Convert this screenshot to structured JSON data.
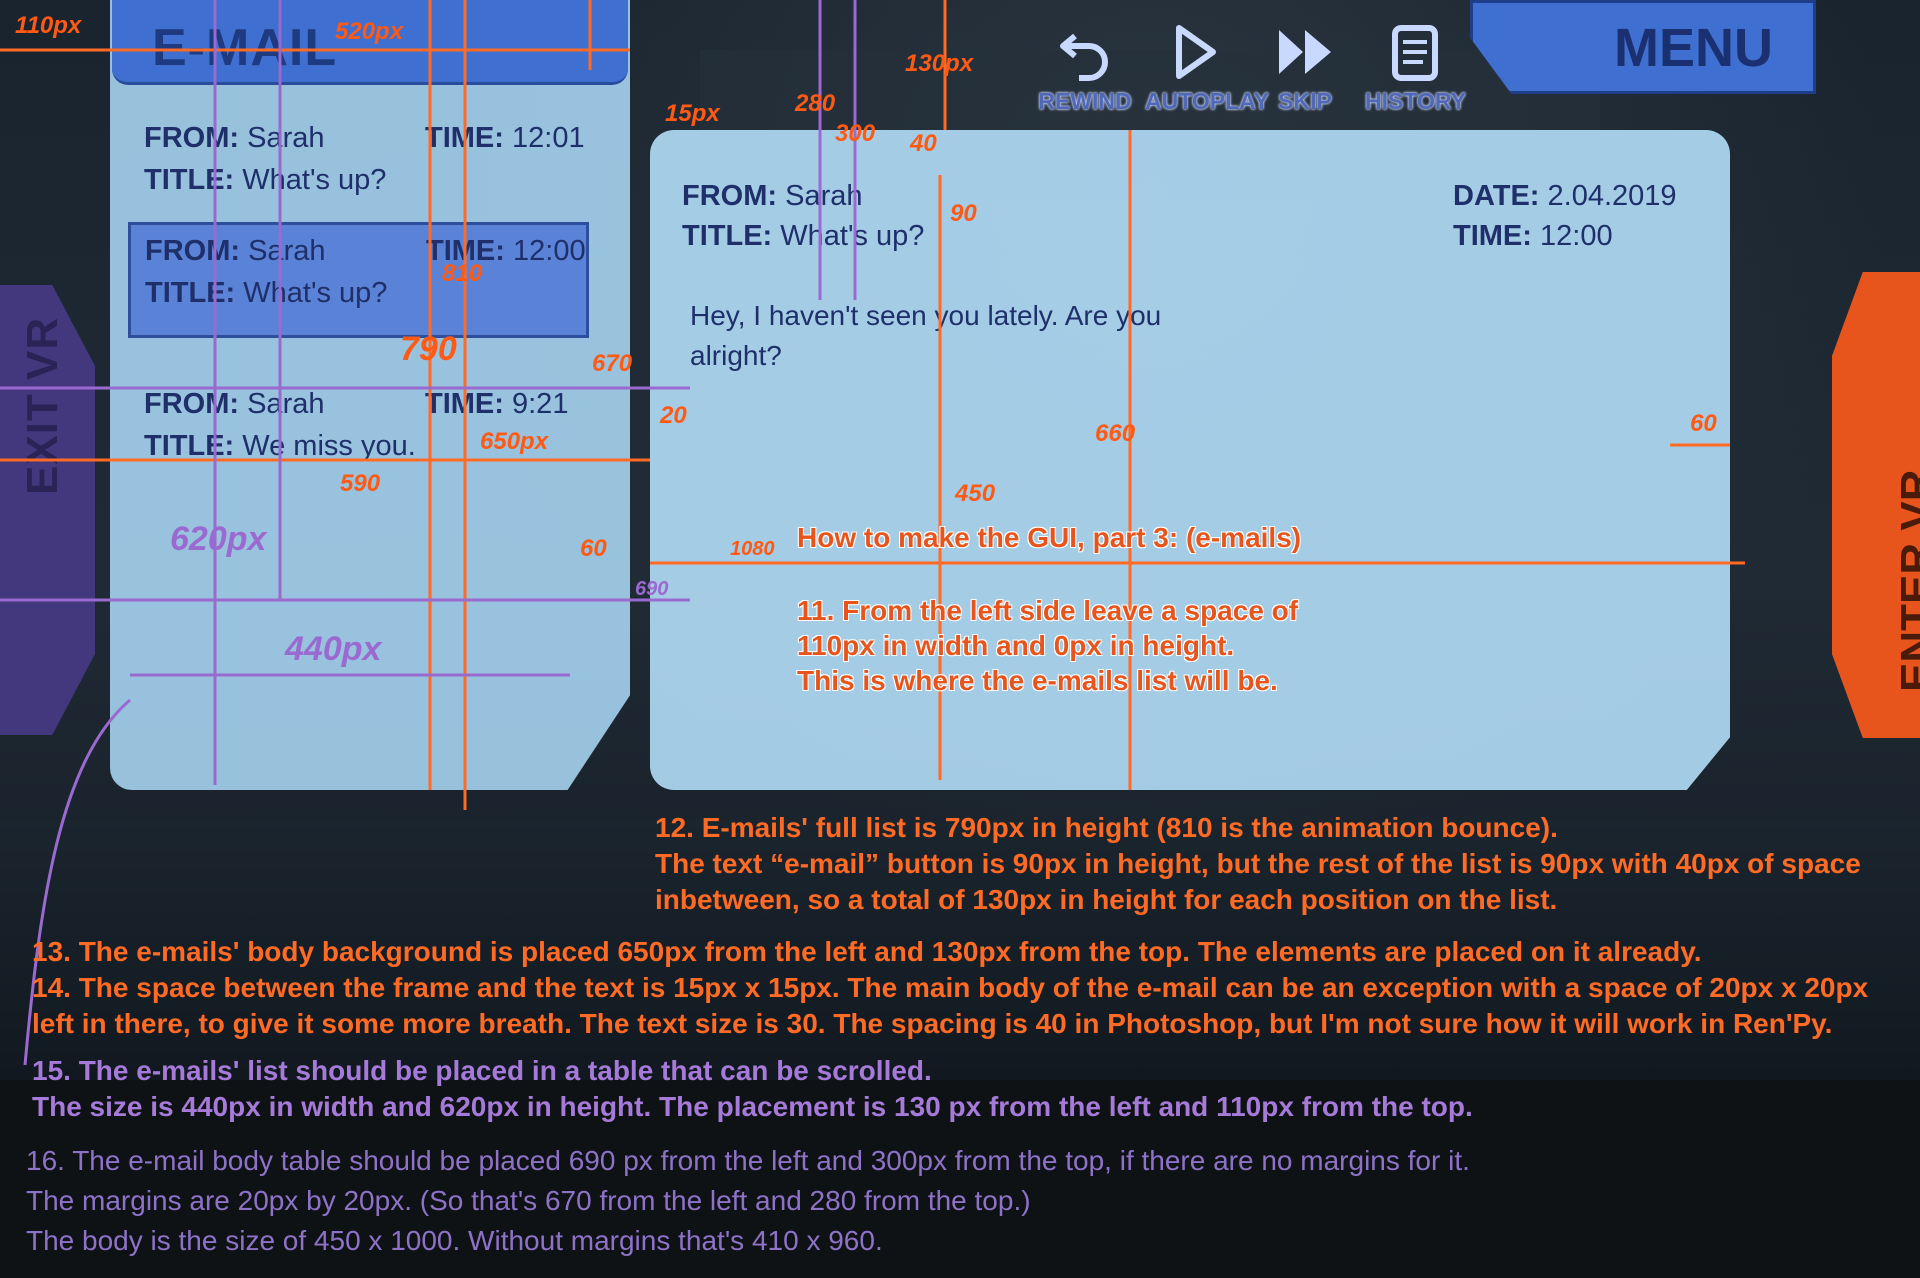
{
  "side": {
    "exit": "EXIT VR",
    "enter": "ENTER VR"
  },
  "topbar": [
    {
      "label": "REWIND",
      "icon": "rewind-icon"
    },
    {
      "label": "AUTOPLAY",
      "icon": "play-icon"
    },
    {
      "label": "SKIP",
      "icon": "skip-icon"
    },
    {
      "label": "HISTORY",
      "icon": "history-icon"
    }
  ],
  "menu": {
    "label": "MENU"
  },
  "list": {
    "header": "E-MAIL",
    "from_label": "FROM:",
    "title_label": "TITLE:",
    "time_label": "TIME:",
    "entries": [
      {
        "from": "Sarah",
        "title": "What's up?",
        "time": "12:01"
      },
      {
        "from": "Sarah",
        "title": "What's up?",
        "time": "12:00"
      },
      {
        "from": "Sarah",
        "title": "We miss you.",
        "time": "9:21"
      }
    ]
  },
  "body": {
    "from_label": "FROM:",
    "from": "Sarah",
    "title_label": "TITLE:",
    "title": "What's up?",
    "date_label": "DATE:",
    "date": "2.04.2019",
    "time_label": "TIME:",
    "time": "12:00",
    "text": "Hey, I haven't seen you lately. Are you alright?"
  },
  "notes": {
    "heading": "How to make the GUI, part 3: (e-mails)",
    "n11_a": "11. From the left side leave a space of",
    "n11_b": "110px in width and 0px in height.",
    "n11_c": "This is where the e-mails list will be."
  },
  "captions": {
    "c12a": "12. E-mails' full list is 790px in height (810 is the animation bounce).",
    "c12b": "The text “e-mail” button is 90px in height, but the rest of the list is 90px with 40px of space",
    "c12c": "inbetween, so a total of 130px in height for each position on the list.",
    "c13": "13. The e-mails' body background is placed 650px from the left and 130px from the top. The elements are placed on it already.",
    "c14a": "14. The space between the frame and the text is 15px x 15px. The main body of the e-mail can be an exception with a space of 20px x 20px",
    "c14b": "left in there, to give it some more breath. The text size is 30. The spacing is 40 in Photoshop, but I'm not sure how it will work in Ren'Py.",
    "c15a": "15. The e-mails' list should be placed in a table that can be scrolled.",
    "c15b": "The size is 440px in width and 620px in height. The placement is 130 px from the left and 110px from the top.",
    "c16a": "16. The e-mail body table should be placed 690 px from the left and 300px from the top, if there are no margins for it.",
    "c16b": "The margins are 20px by 20px. (So that's 670 from the left and 280 from the top.)",
    "c16c": "The body is the size of 450 x 1000. Without margins that's 410 x 960."
  },
  "marks": {
    "m110": "110px",
    "m520": "520px",
    "m15": "15px",
    "m590": "590",
    "m650": "650px",
    "m620": "620px",
    "m440": "440px",
    "m1080": "1080",
    "m690": "690",
    "m670": "670",
    "m60": "60",
    "m20": "20",
    "m790": "790",
    "m810": "810",
    "m660": "660",
    "m450": "450",
    "m280": "280",
    "m300": "300",
    "m130": "130px",
    "m90": "90",
    "m40": "40"
  }
}
